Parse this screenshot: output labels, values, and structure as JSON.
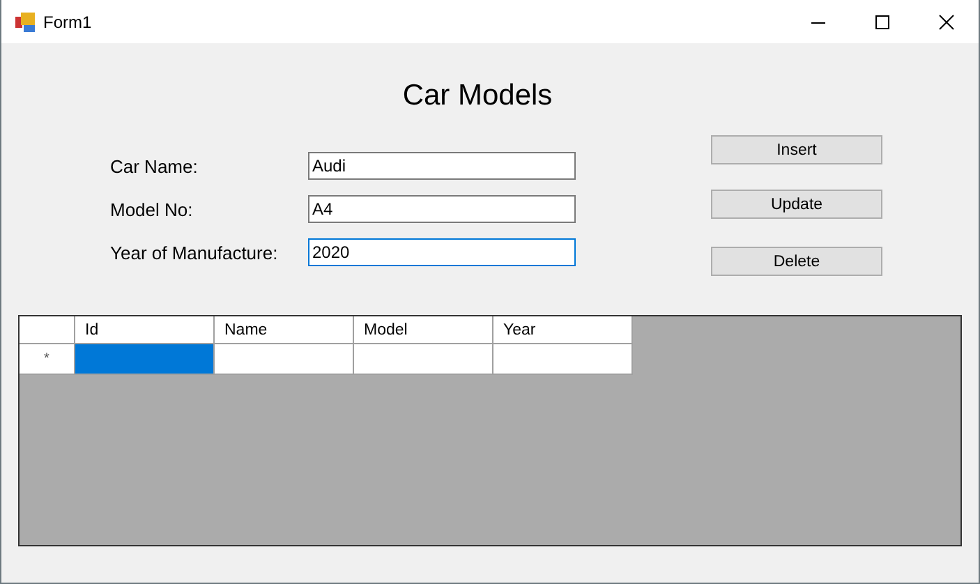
{
  "window": {
    "title": "Form1"
  },
  "heading": "Car Models",
  "fields": [
    {
      "label": "Car Name:",
      "value": "Audi",
      "focused": false
    },
    {
      "label": "Model No:",
      "value": "A4",
      "focused": false
    },
    {
      "label": "Year of Manufacture:",
      "value": "2020",
      "focused": true
    }
  ],
  "buttons": [
    "Insert",
    "Update",
    "Delete"
  ],
  "grid": {
    "columns": [
      "Id",
      "Name",
      "Model",
      "Year"
    ],
    "new_row": {
      "marker": "*",
      "cells": [
        {
          "selected": true
        },
        {
          "selected": false
        },
        {
          "selected": false
        },
        {
          "selected": false
        }
      ]
    }
  }
}
